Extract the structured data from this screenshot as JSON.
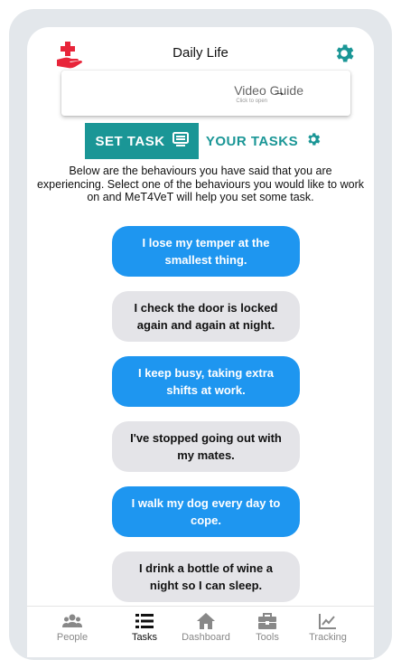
{
  "header": {
    "title": "Daily Life",
    "left_icon": "hand-with-medical-cross-icon",
    "right_icon": "gear-icon"
  },
  "video_guide": {
    "label": "Video Guide",
    "sublabel": "Click to open",
    "arrow": "→"
  },
  "tabs": [
    {
      "label": "SET TASK",
      "icon": "tv-screen-icon",
      "active": true
    },
    {
      "label": "YOUR TASKS",
      "icon": "gear-icon",
      "active": false
    }
  ],
  "intro_text": "Below are the behaviours you have said that you are experiencing. Select one of the behaviours you would like to work on and MeT4VeT will help you set some task.",
  "behaviours": [
    {
      "text": "I lose my temper at the smallest thing.",
      "style": "blue"
    },
    {
      "text": "I check the door is locked again and again at night.",
      "style": "grey"
    },
    {
      "text": "I keep busy, taking extra shifts at work.",
      "style": "blue"
    },
    {
      "text": "I've stopped going out with my mates.",
      "style": "grey"
    },
    {
      "text": "I walk my dog every day to cope.",
      "style": "blue"
    },
    {
      "text": "I drink a bottle of wine a night so I can sleep.",
      "style": "grey"
    }
  ],
  "bottom_nav": [
    {
      "label": "People",
      "icon": "people-icon",
      "active": false
    },
    {
      "label": "Tasks",
      "icon": "list-icon",
      "active": true
    },
    {
      "label": "Dashboard",
      "icon": "home-icon",
      "active": false
    },
    {
      "label": "Tools",
      "icon": "toolbox-icon",
      "active": false
    },
    {
      "label": "Tracking",
      "icon": "chart-icon",
      "active": false
    }
  ],
  "colors": {
    "teal": "#1a9696",
    "blue_pill": "#1e96f0",
    "grey_pill": "#e4e4e8",
    "red_icon": "#e8253a"
  }
}
